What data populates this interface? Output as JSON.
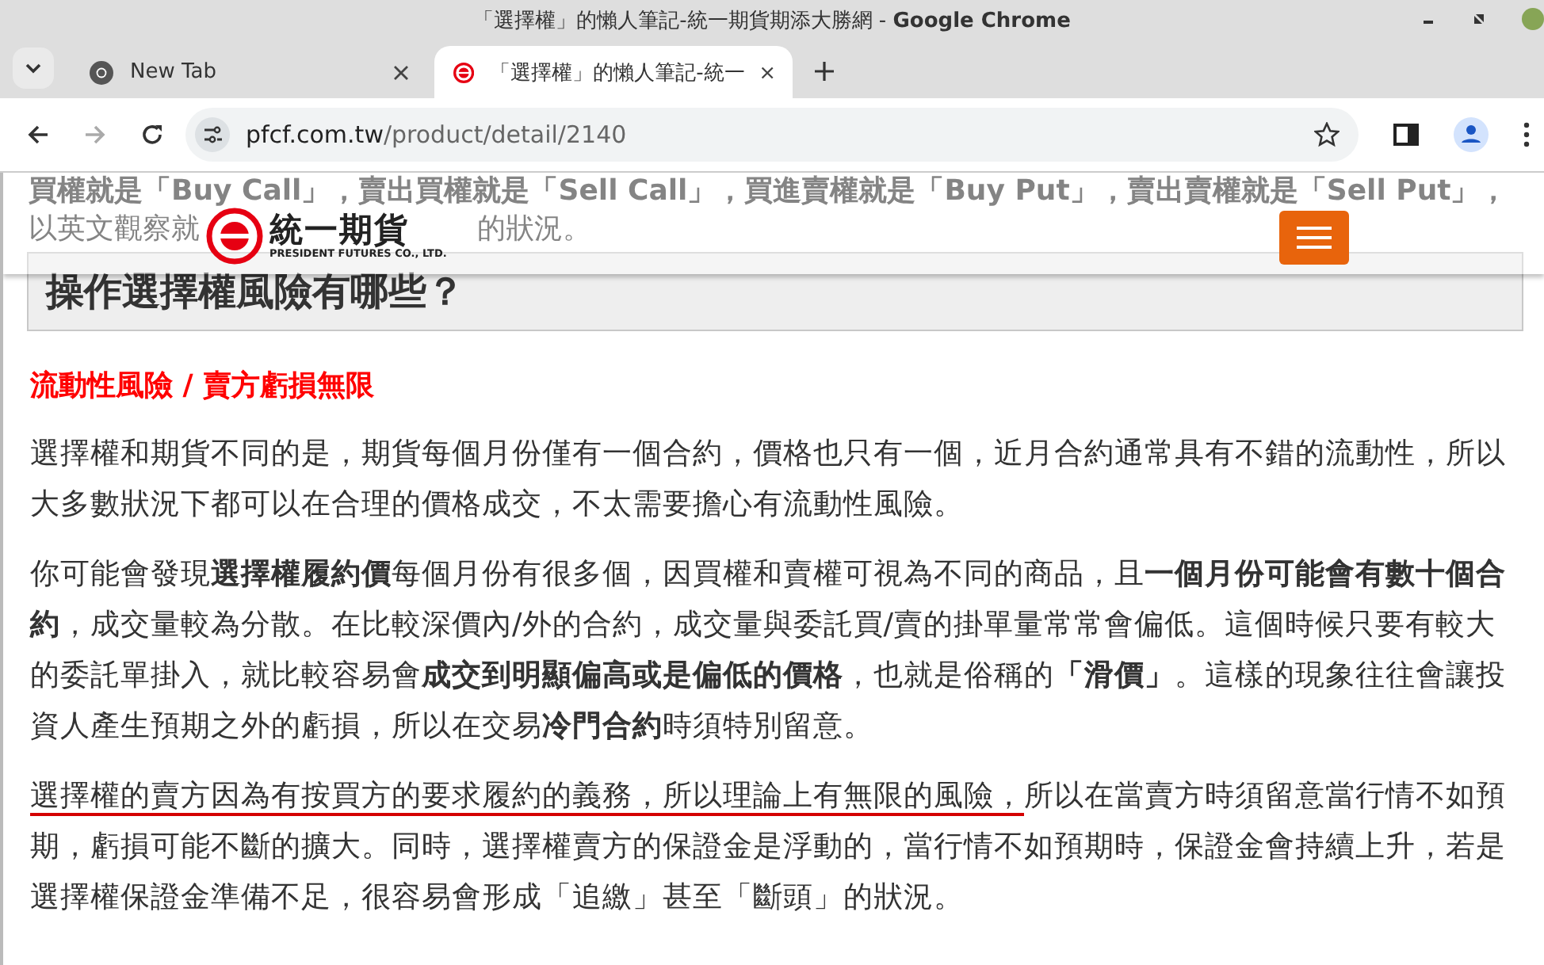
{
  "window": {
    "title": "「選擇權」的懶人筆記-統一期貨期添大勝網 - **Google Chrome**"
  },
  "tabs": [
    {
      "label": "New Tab",
      "selected": false,
      "kind": "newtab"
    },
    {
      "label": "「選擇權」的懶人筆記-統一",
      "selected": true,
      "kind": "site"
    }
  ],
  "address_bar": {
    "domain": "pfcf.com.tw",
    "path": "/product/detail/2140"
  },
  "page": {
    "behind_header": [
      "買權就是「Buy Call」，賣出買權就是「Sell Call」，買進賣權就是「Buy Put」，賣出賣權就是「Sell Put」，",
      "以英文觀察就",
      "的狀況。"
    ],
    "logo": {
      "name": "統一期貨",
      "subtitle": "PRESIDENT FUTURES CO., LTD."
    },
    "heading": "操作選擇權風險有哪些？",
    "subheading": "流動性風險 / 賣方虧損無限",
    "paragraphs": [
      {
        "text": "選擇權和期貨不同的是，期貨每個月份僅有一個合約，價格也只有一個，近月合約通常具有不錯的流動性，所以大多數狀況下都可以在合理的價格成交，不太需要擔心有流動性風險。"
      },
      {
        "text": "你可能會發現**選擇權履約價**每個月份有很多個，因買權和賣權可視為不同的商品，且**一個月份可能會有數十個合約**，成交量較為分散。在比較深價內/外的合約，成交量與委託買/賣的掛單量常常會偏低。這個時候只要有較大的委託單掛入，就比較容易會**成交到明顯偏高或是偏低的價格**，也就是俗稱的**「滑價」**。這樣的現象往往會讓投資人產生預期之外的虧損，所以在交易**冷門合約**時須特別留意。"
      },
      {
        "underlined": "選擇權的賣方因為有按買方的要求履約的義務，所以理論上有無限的風險，",
        "text": "所以在當賣方時須留意當行情不如預期，虧損可能不斷的擴大。同時，選擇權賣方的保證金是浮動的，當行情不如預期時，保證金會持續上升，若是選擇權保證金準備不足，很容易會形成「追繳」甚至「斷頭」的狀況。"
      }
    ]
  }
}
